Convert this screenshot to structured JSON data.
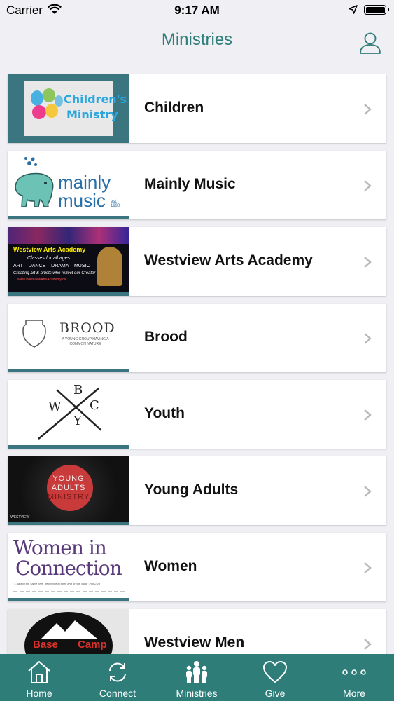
{
  "status": {
    "carrier": "Carrier",
    "time": "9:17 AM"
  },
  "nav": {
    "title": "Ministries",
    "profile_icon": "person-icon"
  },
  "ministries": [
    {
      "label": "Children",
      "thumb": {
        "line1": "Children's",
        "line2": "Ministry"
      }
    },
    {
      "label": "Mainly Music",
      "thumb": {
        "line1": "mainly",
        "line2": "music",
        "est": "est. 1990"
      }
    },
    {
      "label": "Westview Arts Academy",
      "thumb": {
        "title": "Westview Arts Academy",
        "tagline": "Classes for all ages...",
        "disciplines": "ART DANCE DRAMA MUSIC",
        "sub": "Creating art & artists who reflect our Creator",
        "url": "www.WestviewArtsAcademy.ca"
      }
    },
    {
      "label": "Brood",
      "thumb": {
        "title": "BROOD",
        "sub": "A YOUNG GROUP HAVING A COMMON NATURE"
      }
    },
    {
      "label": "Youth",
      "thumb": {
        "b": "B",
        "w": "W",
        "c": "C",
        "y": "Y"
      }
    },
    {
      "label": "Young Adults",
      "thumb": {
        "line1": "YOUNG",
        "line2": "ADULTS",
        "line3": "MINISTRY",
        "brand": "WESTVIEW"
      }
    },
    {
      "label": "Women",
      "thumb": {
        "line1": "Women in",
        "line2": "Connection",
        "quote": "\"...having the same love, being one in spirit and of one mind\" Phil 2:2b"
      }
    },
    {
      "label": "Westview Men",
      "thumb": {
        "line1": "Base",
        "line2": "Camp"
      }
    }
  ],
  "tabs": [
    {
      "label": "Home",
      "icon": "home-icon"
    },
    {
      "label": "Connect",
      "icon": "sync-icon"
    },
    {
      "label": "Ministries",
      "icon": "people-icon"
    },
    {
      "label": "Give",
      "icon": "heart-icon"
    },
    {
      "label": "More",
      "icon": "more-icon"
    }
  ]
}
